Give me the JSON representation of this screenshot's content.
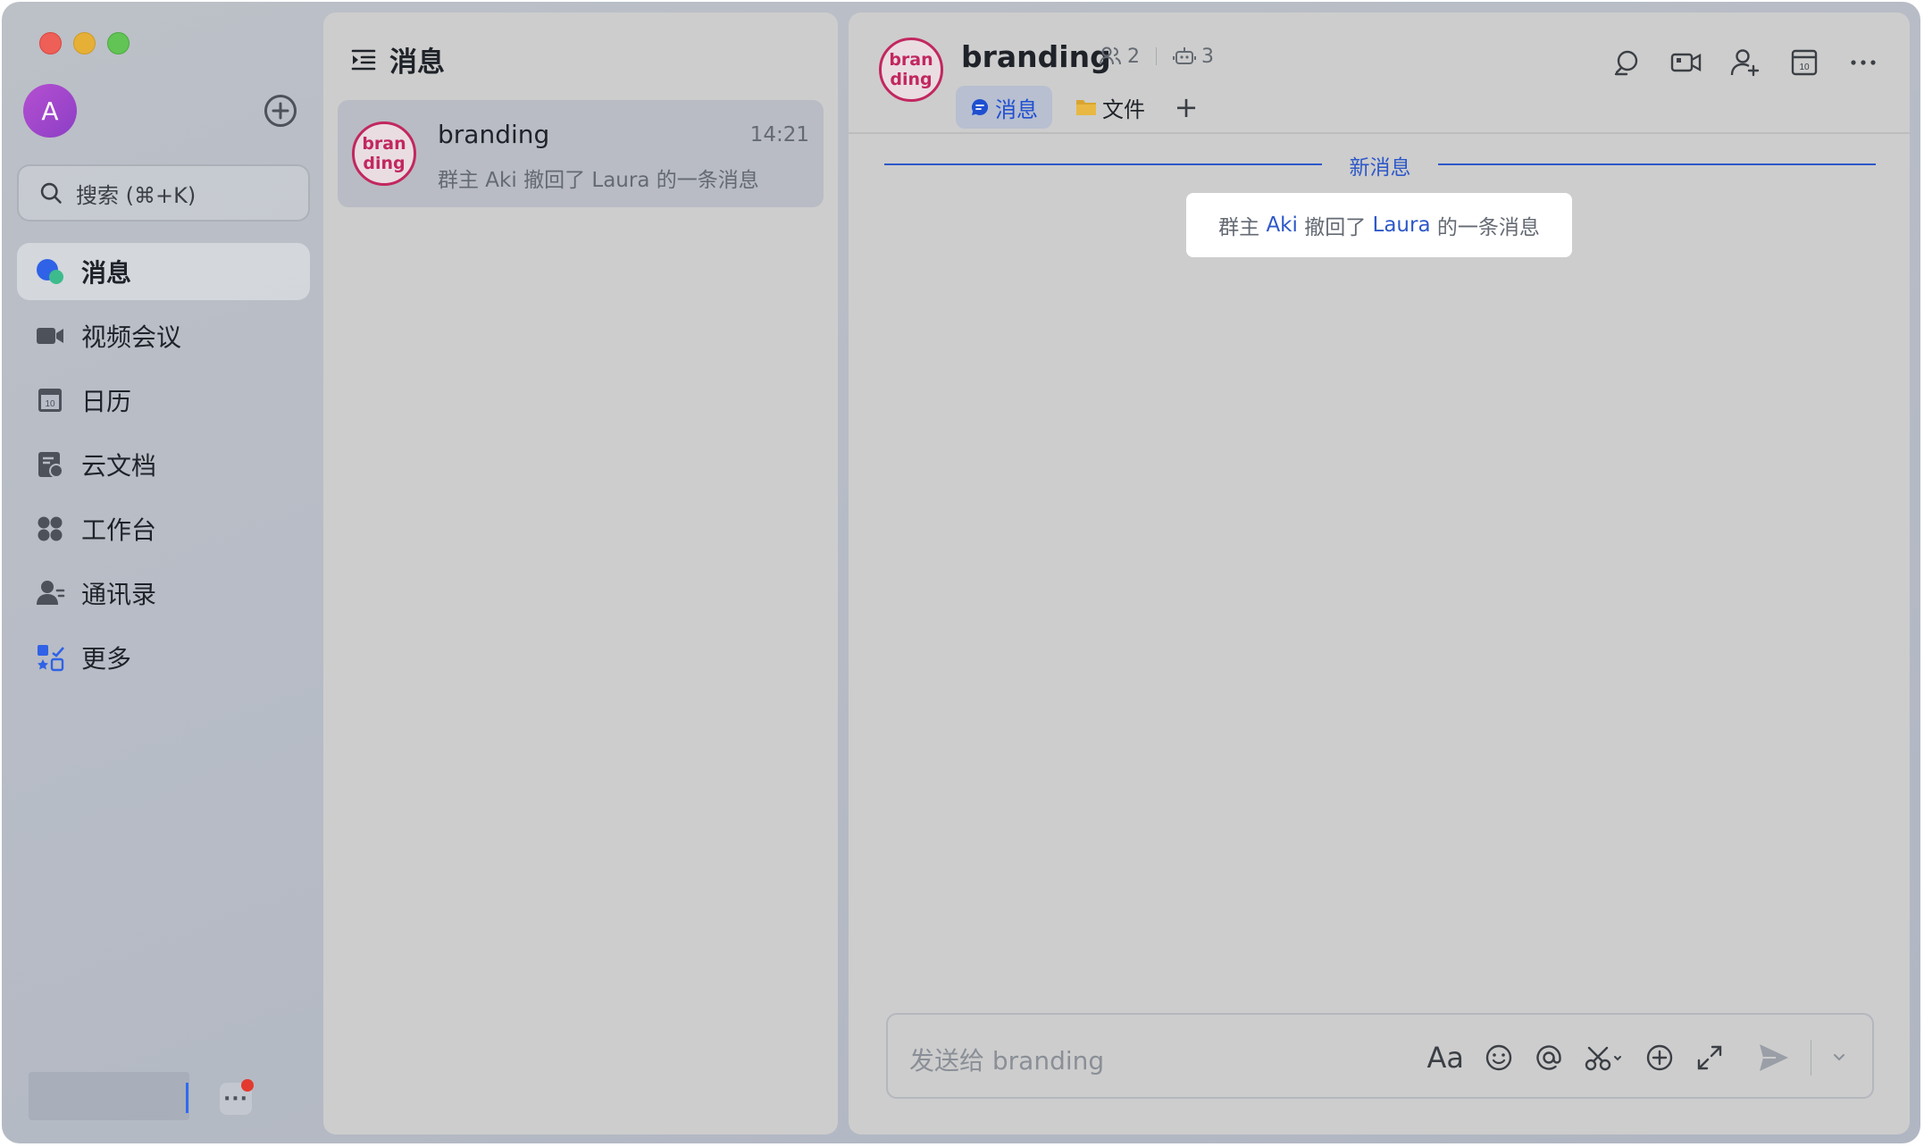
{
  "sidebar": {
    "avatar_initial": "A",
    "search_placeholder": "搜索 (⌘+K)",
    "items": [
      {
        "label": "消息",
        "icon": "message-icon"
      },
      {
        "label": "视频会议",
        "icon": "video-icon"
      },
      {
        "label": "日历",
        "icon": "calendar-icon"
      },
      {
        "label": "云文档",
        "icon": "docs-icon"
      },
      {
        "label": "工作台",
        "icon": "workspace-icon"
      },
      {
        "label": "通讯录",
        "icon": "contacts-icon"
      },
      {
        "label": "更多",
        "icon": "more-apps-icon"
      }
    ],
    "more_button": "···"
  },
  "chat_list": {
    "title": "消息",
    "items": [
      {
        "avatar_text": "bran\nding",
        "name": "branding",
        "time": "14:21",
        "preview": "群主 Aki 撤回了 Laura 的一条消息"
      }
    ]
  },
  "conversation": {
    "avatar_text": "bran\nding",
    "title": "branding",
    "member_count": "2",
    "bot_count": "3",
    "tabs": [
      {
        "label": "消息",
        "icon": "chat-bubble-icon"
      },
      {
        "label": "文件",
        "icon": "folder-icon"
      }
    ],
    "add_tab": "+",
    "new_messages_label": "新消息",
    "system_message": {
      "prefix": "群主",
      "actor": "Aki",
      "verb": "撤回了",
      "target": "Laura",
      "suffix": "的一条消息"
    },
    "composer_placeholder": "发送给 branding",
    "composer_font_tool": "Aa"
  },
  "colors": {
    "accent": "#2d58c8",
    "group_avatar": "#c2275f",
    "unread_dot": "#e33a2f"
  }
}
